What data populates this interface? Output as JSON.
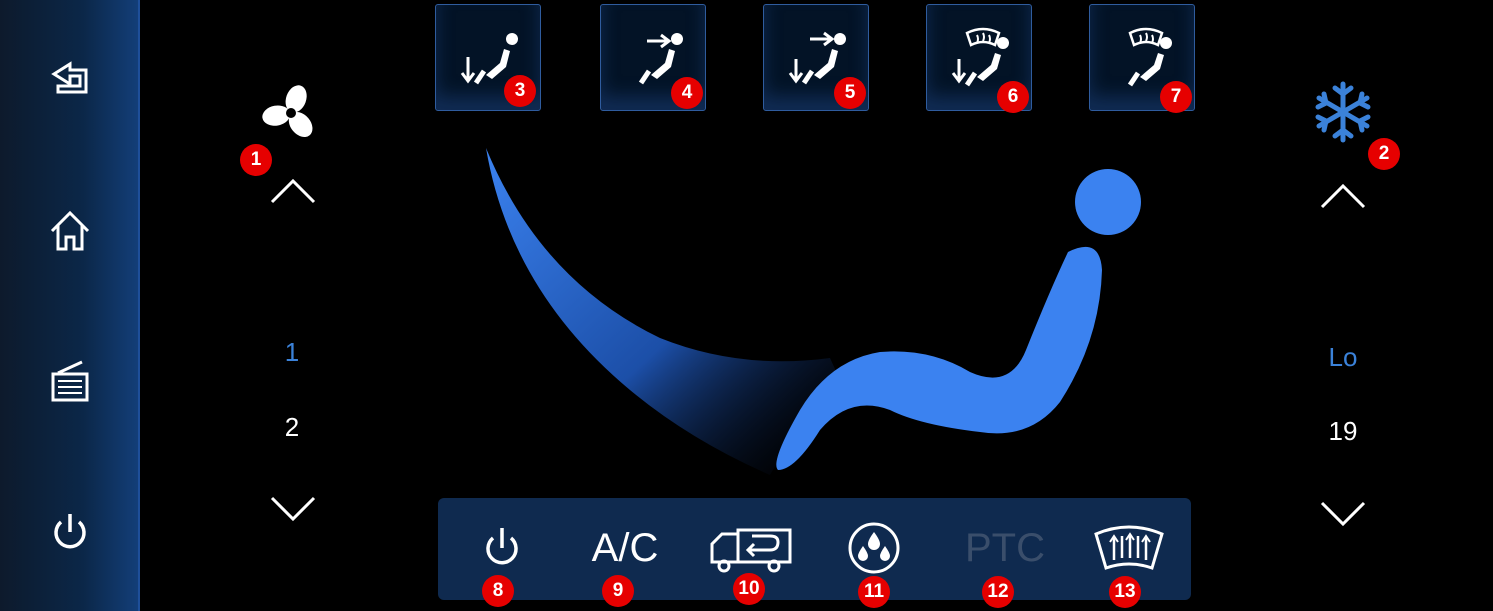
{
  "sidebar": {
    "items": [
      {
        "name": "back",
        "icon": "back-icon"
      },
      {
        "name": "home",
        "icon": "home-icon"
      },
      {
        "name": "radio",
        "icon": "radio-icon"
      },
      {
        "name": "power",
        "icon": "power-icon"
      }
    ]
  },
  "fan": {
    "icon": "fan-icon",
    "levels": [
      "1",
      "2"
    ],
    "selected": "1"
  },
  "temperature": {
    "icon": "snowflake-icon",
    "levels": [
      "Lo",
      "19"
    ],
    "selected": "Lo"
  },
  "mode_buttons": [
    {
      "badge": "3",
      "icon": "airflow-feet-icon"
    },
    {
      "badge": "4",
      "icon": "airflow-face-icon"
    },
    {
      "badge": "5",
      "icon": "airflow-face-feet-icon"
    },
    {
      "badge": "6",
      "icon": "airflow-defrost-feet-icon"
    },
    {
      "badge": "7",
      "icon": "airflow-defrost-icon"
    }
  ],
  "badges": {
    "fan": "1",
    "temperature": "2"
  },
  "bottom_bar": {
    "power": {
      "icon": "power-icon",
      "badge": "8"
    },
    "ac": {
      "label": "A/C",
      "badge": "9"
    },
    "recirc": {
      "icon": "recirculation-icon",
      "badge": "10"
    },
    "dehumidify": {
      "icon": "droplets-icon",
      "badge": "11"
    },
    "ptc": {
      "label": "PTC",
      "badge": "12",
      "enabled": false
    },
    "rear_defrost": {
      "icon": "rear-defrost-icon",
      "badge": "13"
    }
  },
  "colors": {
    "accent": "#3b82d9",
    "badge": "#e60000",
    "bar": "#0f2a4f",
    "disabled": "#3a4e6b"
  }
}
